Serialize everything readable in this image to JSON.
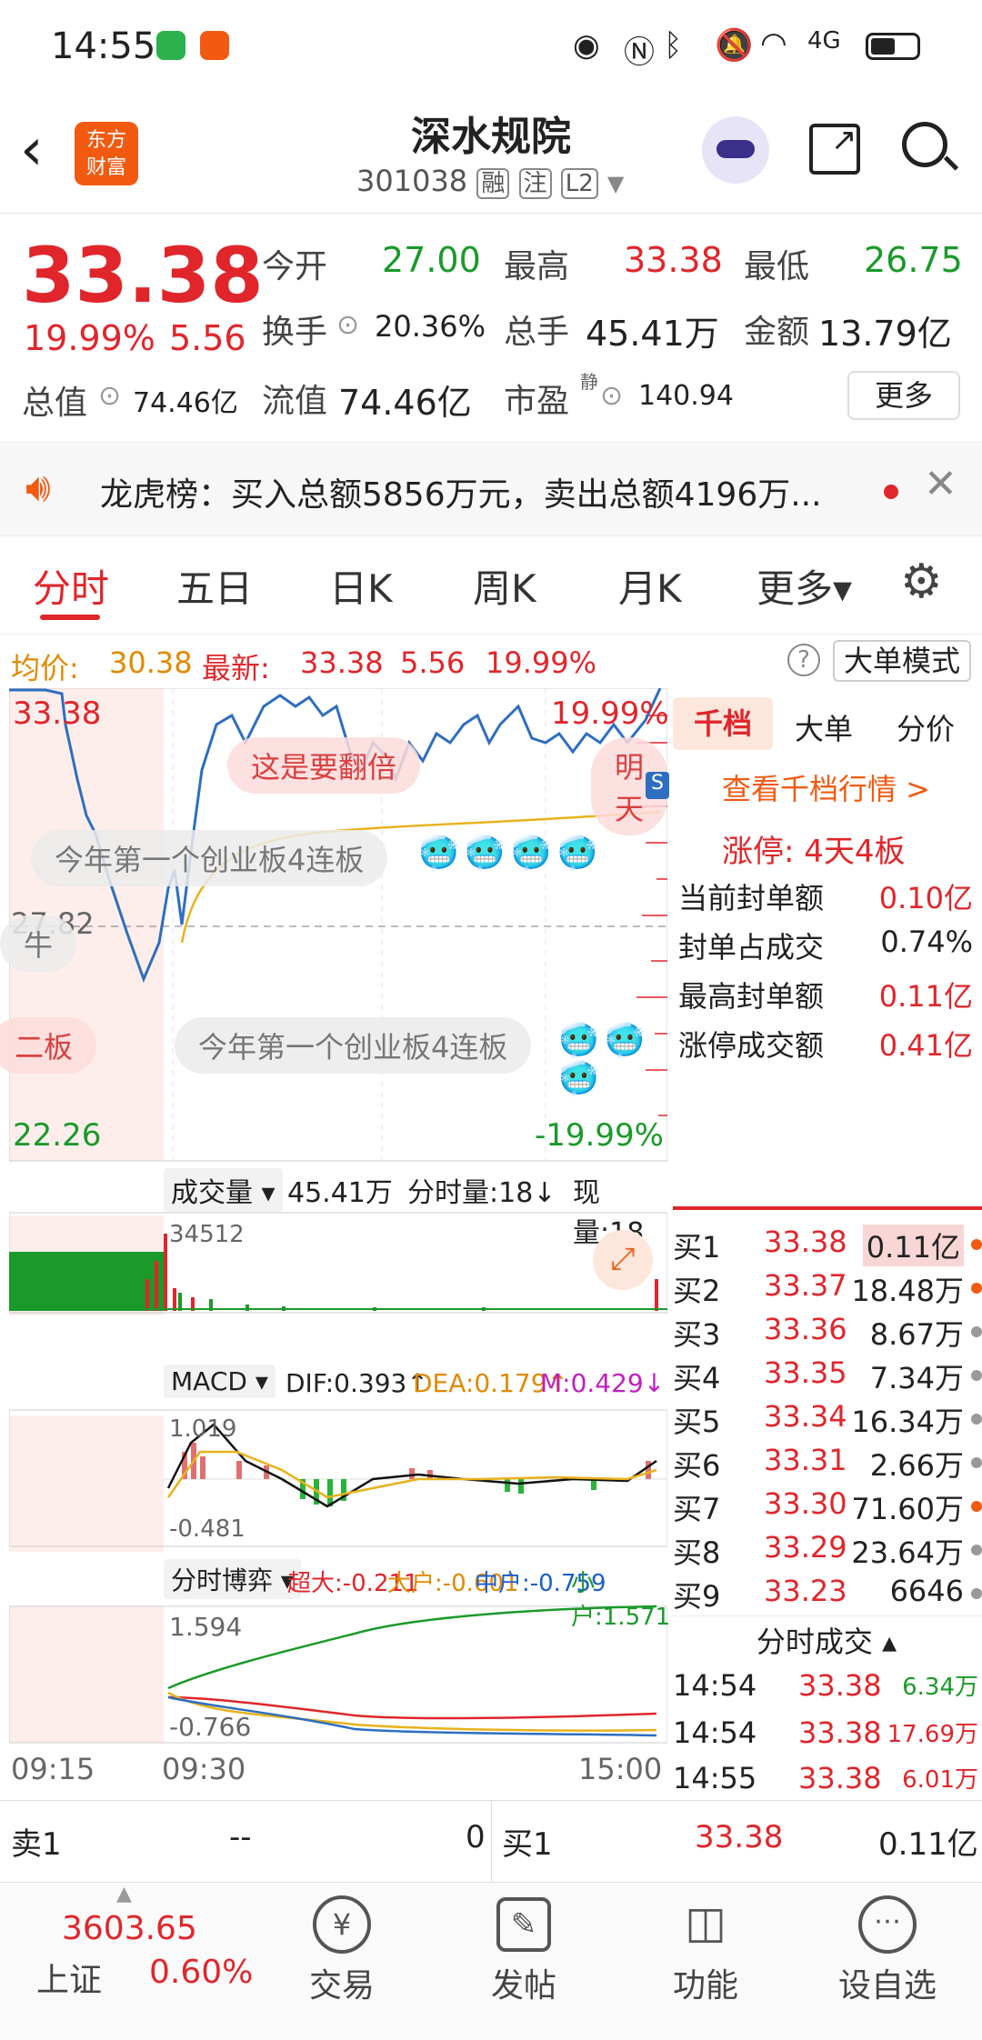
{
  "status_bar": {
    "time": "14:55",
    "network": "4G"
  },
  "header": {
    "back": "back-arrow",
    "logo_line1": "东方",
    "logo_line2": "财富",
    "title": "深水规院",
    "code": "301038",
    "tags": [
      "融",
      "注",
      "L2"
    ]
  },
  "quote": {
    "price": "33.38",
    "pct": "19.99%",
    "chg": "5.56",
    "open_label": "今开",
    "open": "27.00",
    "high_label": "最高",
    "high": "33.38",
    "low_label": "最低",
    "low": "26.75",
    "turnover_label": "换手",
    "turnover": "20.36%",
    "vol_label": "总手",
    "vol": "45.41万",
    "amount_label": "金额",
    "amount": "13.79亿",
    "mcap_label": "总值",
    "mcap": "74.46亿",
    "float_label": "流值",
    "float": "74.46亿",
    "pe_label": "市盈",
    "pe_sup": "静",
    "pe": "140.94",
    "more": "更多"
  },
  "dragon": {
    "text": "龙虎榜：买入总额5856万元，卖出总额4196万..."
  },
  "tabs": [
    "分时",
    "五日",
    "日K",
    "周K",
    "月K",
    "更多▾"
  ],
  "info": {
    "avg_label": "均价:",
    "avg": "30.38",
    "last_label": "最新:",
    "last": "33.38",
    "chg": "5.56",
    "pct": "19.99%",
    "mode": "大单模式"
  },
  "chart": {
    "top_left": "33.38",
    "top_right": "19.99%",
    "mid": "27.82",
    "bottom_left": "22.26",
    "bottom_right": "-19.99%",
    "bubble1": "这是要翻倍",
    "bubble2": "明天",
    "bubble3": "今年第一个创业板4连板",
    "bubble4": "今年第一个创业板4连板",
    "bubble5": "二板",
    "bubble6": "牛",
    "vol_sel": "成交量",
    "vol_total": "45.41万",
    "vol_time": "分时量:18↓",
    "vol_now": "现量:18",
    "vol_max": "34512",
    "macd_sel": "MACD",
    "dif": "DIF:0.393↑",
    "dea": "DEA:0.179↑",
    "m": "M:0.429↓",
    "macd_hi": "1.019",
    "macd_lo": "-0.481",
    "flow_sel": "分时博弈",
    "super": "超大:-0.211",
    "big": "大户:-0.601",
    "mid_f": "中户:-0.759",
    "small": "小户:1.571",
    "flow_hi": "1.594",
    "flow_lo": "-0.766",
    "t1": "09:15",
    "t2": "09:30",
    "t3": "15:00"
  },
  "side": {
    "tabs": [
      "千档",
      "大单",
      "分价"
    ],
    "link": "查看千档行情 >",
    "limit": "涨停:  4天4板",
    "rows": [
      {
        "label": "当前封单额",
        "value": "0.10亿"
      },
      {
        "label": "封单占成交",
        "value": "0.74%"
      },
      {
        "label": "最高封单额",
        "value": "0.11亿"
      },
      {
        "label": "涨停成交额",
        "value": "0.41亿"
      }
    ],
    "book": [
      {
        "n": "买1",
        "p": "33.38",
        "q": "0.11亿"
      },
      {
        "n": "买2",
        "p": "33.37",
        "q": "18.48万"
      },
      {
        "n": "买3",
        "p": "33.36",
        "q": "8.67万"
      },
      {
        "n": "买4",
        "p": "33.35",
        "q": "7.34万"
      },
      {
        "n": "买5",
        "p": "33.34",
        "q": "16.34万"
      },
      {
        "n": "买6",
        "p": "33.31",
        "q": "2.66万"
      },
      {
        "n": "买7",
        "p": "33.30",
        "q": "71.60万"
      },
      {
        "n": "买8",
        "p": "33.29",
        "q": "23.64万"
      },
      {
        "n": "买9",
        "p": "33.23",
        "q": "6646"
      }
    ],
    "trades_title": "分时成交",
    "trades": [
      {
        "t": "14:54",
        "p": "33.38",
        "v": "6.34万"
      },
      {
        "t": "14:54",
        "p": "33.38",
        "v": "17.69万"
      },
      {
        "t": "14:55",
        "p": "33.38",
        "v": "6.01万"
      }
    ]
  },
  "bottom_quote": {
    "sell_label": "卖1",
    "sell_price": "--",
    "sell_vol": "0",
    "buy_label": "买1",
    "buy_price": "33.38",
    "buy_vol": "0.11亿"
  },
  "nav": {
    "index_value": "3603.65",
    "index_name": "上证",
    "index_pct": "0.60%",
    "items": [
      "交易",
      "发帖",
      "功能",
      "设自选"
    ]
  },
  "colors": {
    "up": "#e0262b",
    "down": "#1a9a2a",
    "accent": "#f25a12"
  }
}
